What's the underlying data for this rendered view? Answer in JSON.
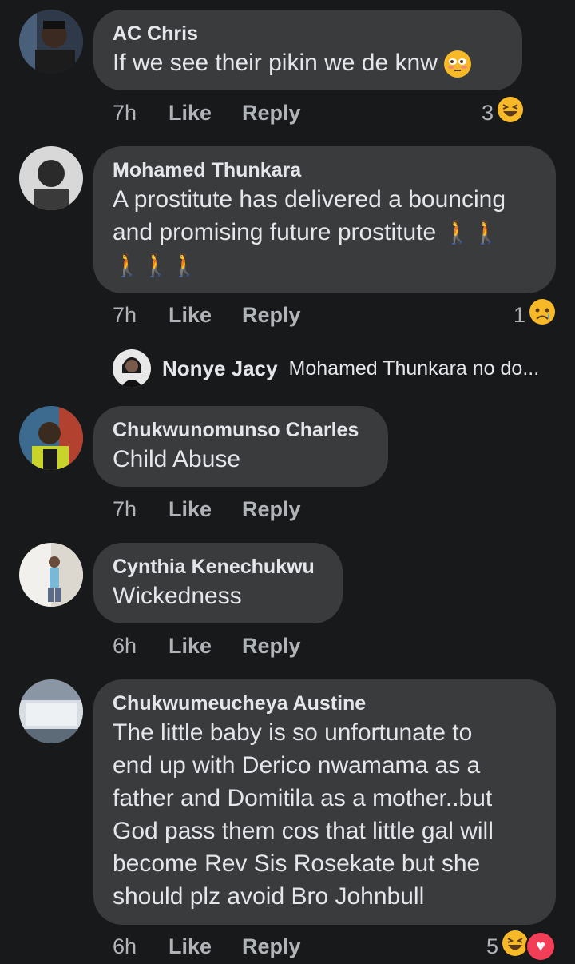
{
  "comments": [
    {
      "name": "AC Chris",
      "lines": [
        "If we see their pikin we de knw"
      ],
      "time": "7h",
      "like": "Like",
      "reply": "Reply",
      "reaction_count": "3"
    },
    {
      "name": "Mohamed Thunkara",
      "lines": [
        "A prostitute has delivered a bouncing",
        "and promising future prostitute"
      ],
      "time": "7h",
      "like": "Like",
      "reply": "Reply",
      "reaction_count": "1",
      "reply_preview": {
        "name": "Nonye Jacy",
        "text": "Mohamed Thunkara no do..."
      }
    },
    {
      "name": "Chukwunomunso Charles",
      "lines": [
        "Child Abuse"
      ],
      "time": "7h",
      "like": "Like",
      "reply": "Reply"
    },
    {
      "name": "Cynthia Kenechukwu",
      "lines": [
        "Wickedness"
      ],
      "time": "6h",
      "like": "Like",
      "reply": "Reply"
    },
    {
      "name": "Chukwumeucheya Austine",
      "lines": [
        "The little baby is so unfortunate to",
        "end up with Derico nwamama as a",
        "father and Domitila as a mother..but",
        "God pass them cos that little gal will",
        "become Rev Sis Rosekate but she",
        "should plz avoid Bro Johnbull"
      ],
      "time": "6h",
      "like": "Like",
      "reply": "Reply",
      "reaction_count": "5"
    }
  ],
  "colors": {
    "background": "#18191a",
    "bubble": "#3a3b3c",
    "text": "#e4e6eb",
    "meta": "#b0b3b8",
    "haha": "#f7b928",
    "love": "#f33e58"
  }
}
